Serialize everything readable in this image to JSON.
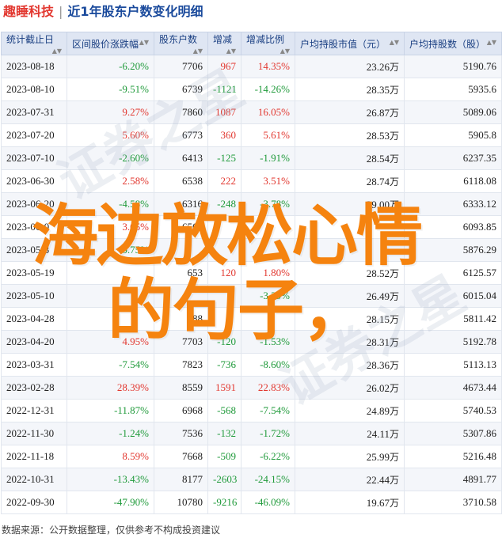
{
  "header": {
    "company": "趣睡科技",
    "subject": "近1年股东户数变化明细"
  },
  "columns": [
    "统计截止日",
    "区间股价涨跌幅",
    "股东户数",
    "增减",
    "增减比例",
    "户均持股市值（元）",
    "户均持股数（股）"
  ],
  "rows": [
    {
      "date": "2023-08-18",
      "chg": "-6.20%",
      "holders": "7706",
      "delta": "967",
      "ratio": "14.35%",
      "value": "23.26",
      "shares": "5190.76"
    },
    {
      "date": "2023-08-10",
      "chg": "-9.51%",
      "holders": "6739",
      "delta": "-1121",
      "ratio": "-14.26%",
      "value": "28.35",
      "shares": "5935.6"
    },
    {
      "date": "2023-07-31",
      "chg": "9.27%",
      "holders": "7860",
      "delta": "1087",
      "ratio": "16.05%",
      "value": "26.87",
      "shares": "5089.06"
    },
    {
      "date": "2023-07-20",
      "chg": "5.60%",
      "holders": "6773",
      "delta": "360",
      "ratio": "5.61%",
      "value": "28.53",
      "shares": "5905.8"
    },
    {
      "date": "2023-07-10",
      "chg": "-2.60%",
      "holders": "6413",
      "delta": "-125",
      "ratio": "-1.91%",
      "value": "28.54",
      "shares": "6237.35"
    },
    {
      "date": "2023-06-30",
      "chg": "2.58%",
      "holders": "6538",
      "delta": "222",
      "ratio": "3.51%",
      "value": "28.74",
      "shares": "6118.08"
    },
    {
      "date": "2023-06-20",
      "chg": "-4.58%",
      "holders": "6316",
      "delta": "-248",
      "ratio": "-3.78%",
      "value": "29.00",
      "shares": "6333.12"
    },
    {
      "date": "2023-06-0",
      "chg": "3.05%",
      "holders": "6564",
      "delta": "",
      "ratio": "",
      "value": "",
      "shares": "6093.85"
    },
    {
      "date": "2023-05-3",
      "chg": "-0.75%",
      "holders": "",
      "delta": "",
      "ratio": "",
      "value": "",
      "shares": "5876.29"
    },
    {
      "date": "2023-05-19",
      "chg": "",
      "holders": "653",
      "delta": "120",
      "ratio": "1.80%",
      "value": "28.52",
      "shares": "6125.57"
    },
    {
      "date": "2023-05-10",
      "chg": "",
      "holders": "",
      "delta": "",
      "ratio": "-3.39%",
      "value": "26.49",
      "shares": "6015.04"
    },
    {
      "date": "2023-04-28",
      "chg": "",
      "holders": "688",
      "delta": "",
      "ratio": "",
      "value": "28.15",
      "shares": "5811.42"
    },
    {
      "date": "2023-04-20",
      "chg": "4.95%",
      "holders": "7703",
      "delta": "-120",
      "ratio": "-1.53%",
      "value": "28.31",
      "shares": "5192.78"
    },
    {
      "date": "2023-03-31",
      "chg": "-7.54%",
      "holders": "7823",
      "delta": "-736",
      "ratio": "-8.60%",
      "value": "28.36",
      "shares": "5113.13"
    },
    {
      "date": "2023-02-28",
      "chg": "28.39%",
      "holders": "8559",
      "delta": "1591",
      "ratio": "22.83%",
      "value": "26.02",
      "shares": "4673.44"
    },
    {
      "date": "2022-12-31",
      "chg": "-11.87%",
      "holders": "6968",
      "delta": "-568",
      "ratio": "-7.54%",
      "value": "24.89",
      "shares": "5740.53"
    },
    {
      "date": "2022-11-30",
      "chg": "-1.24%",
      "holders": "7536",
      "delta": "-132",
      "ratio": "-1.72%",
      "value": "24.11",
      "shares": "5307.86"
    },
    {
      "date": "2022-11-18",
      "chg": "8.59%",
      "holders": "7668",
      "delta": "-509",
      "ratio": "-6.22%",
      "value": "25.99",
      "shares": "5216.48"
    },
    {
      "date": "2022-10-31",
      "chg": "-13.43%",
      "holders": "8177",
      "delta": "-2603",
      "ratio": "-24.15%",
      "value": "22.44",
      "shares": "4891.77"
    },
    {
      "date": "2022-09-30",
      "chg": "-47.90%",
      "holders": "10780",
      "delta": "-9216",
      "ratio": "-46.09%",
      "value": "19.67",
      "shares": "3710.58"
    }
  ],
  "value_unit": "万",
  "footer": "数据来源：公开数据整理，仅供参考不构成投资建议",
  "overlay": {
    "line1": "海边放松心情",
    "line2": "的句子，"
  },
  "colors": {
    "up": "#e2372f",
    "down": "#1f9a3a",
    "overlay": "#f5830f",
    "header_bg": "#dfe6f3"
  }
}
